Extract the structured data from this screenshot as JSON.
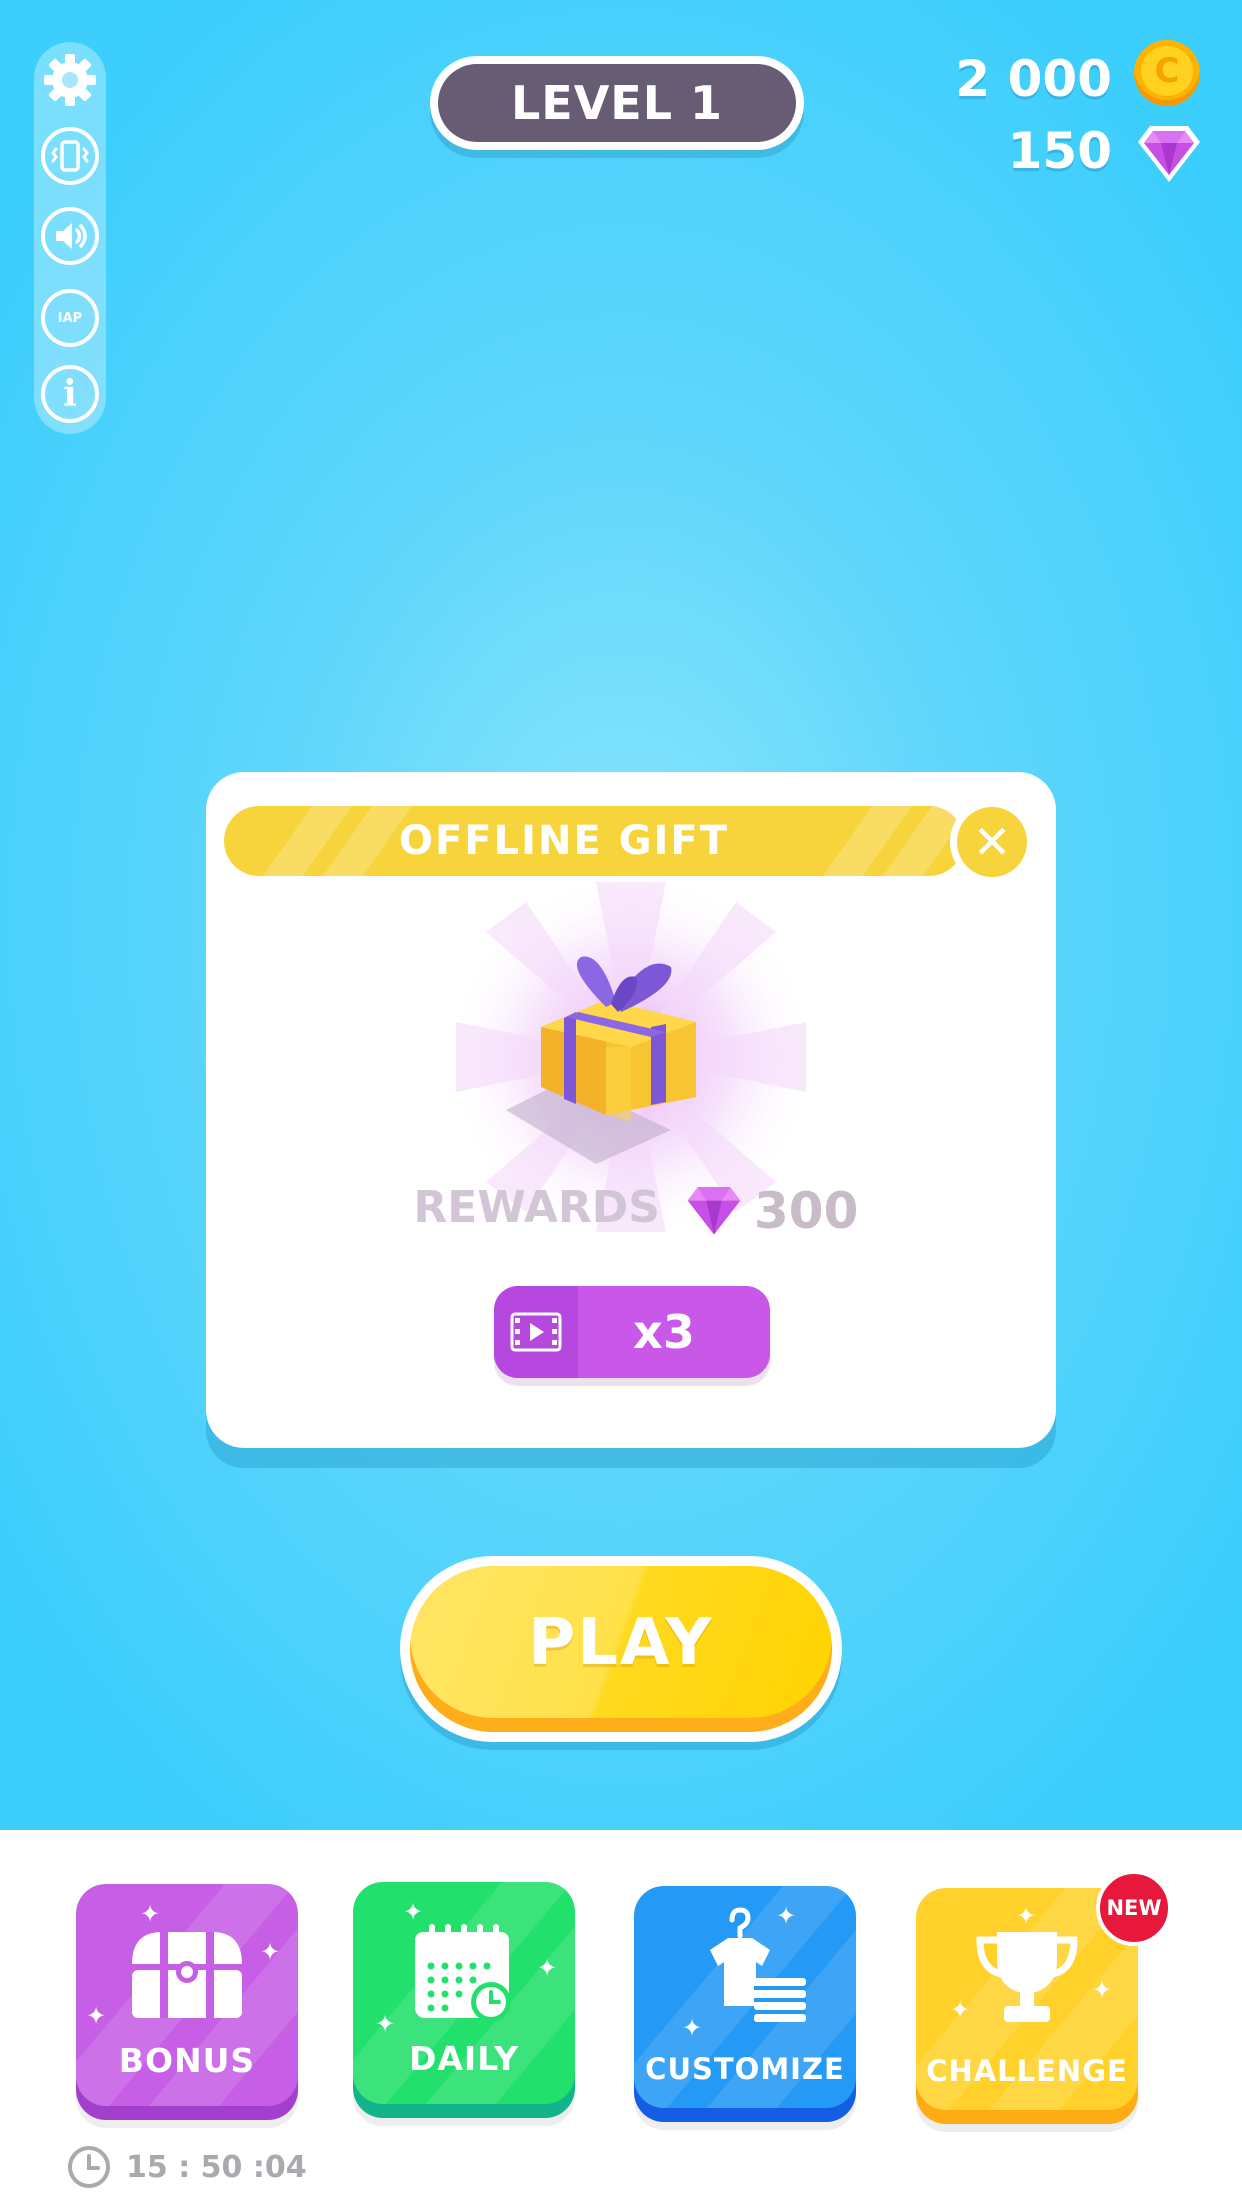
{
  "header": {
    "level_label": "LEVEL 1",
    "coins": "2 000",
    "coin_symbol": "C",
    "gems": "150"
  },
  "side_menu": {
    "items": [
      {
        "icon": "gear-icon"
      },
      {
        "icon": "vibration-icon"
      },
      {
        "icon": "sound-icon"
      },
      {
        "icon": "restore-purchases-icon",
        "text": "IAP"
      },
      {
        "icon": "info-icon",
        "text": "i"
      }
    ]
  },
  "offline_gift": {
    "title": "OFFLINE GIFT",
    "close_symbol": "✕",
    "rewards_label": "REWARDS",
    "rewards_value": "300",
    "multiplier_label": "x3"
  },
  "play_button": {
    "label": "PLAY"
  },
  "bottom_menu": {
    "tiles": [
      {
        "label": "BONUS",
        "color": "#c75ee6"
      },
      {
        "label": "DAILY",
        "color": "#22e06c"
      },
      {
        "label": "CUSTOMIZE",
        "color": "#2499f5"
      },
      {
        "label": "CHALLENGE",
        "color": "#ffd12a"
      }
    ],
    "new_badge": "NEW",
    "timer": "15 : 50 :04"
  },
  "colors": {
    "sky": "#3ccefc",
    "accent_yellow": "#f7d43c",
    "gem_purple": "#c84fe6",
    "level_pill": "#675c73"
  }
}
